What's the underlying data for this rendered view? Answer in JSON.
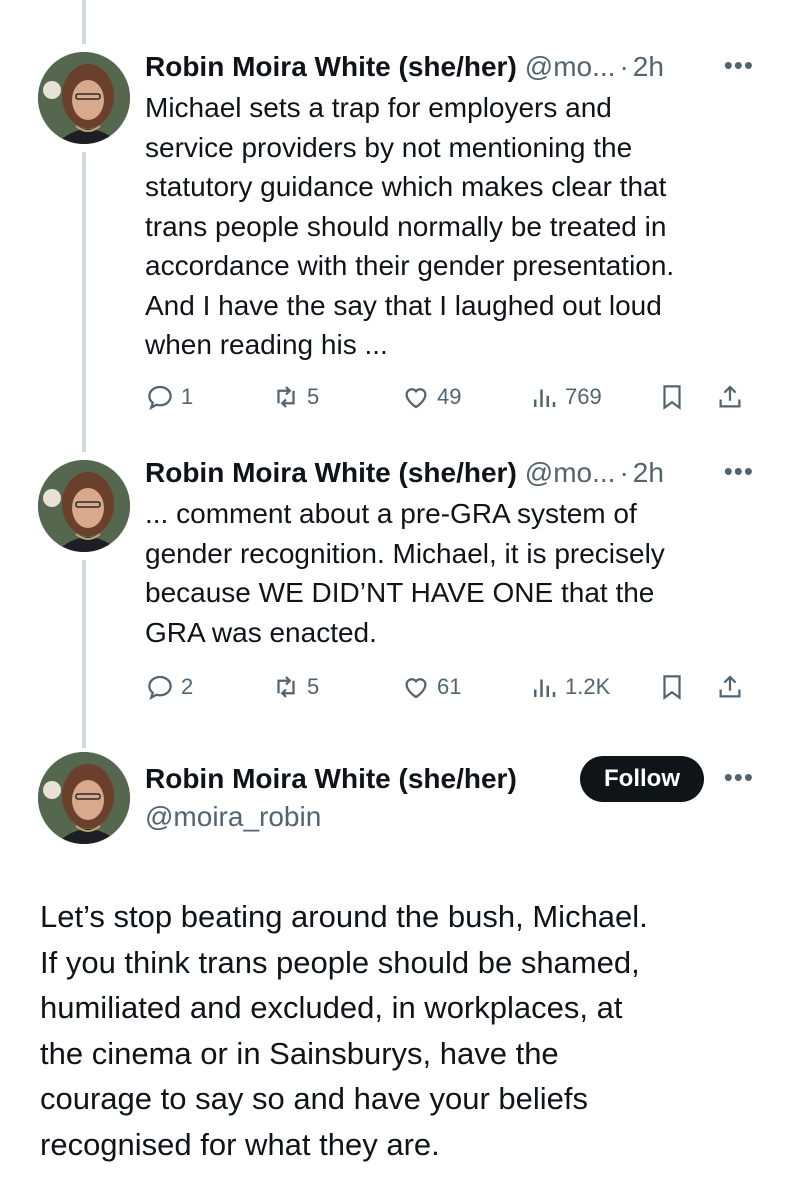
{
  "tweets": [
    {
      "author_name": "Robin Moira White (she/her)",
      "handle": "@mo...",
      "time": "2h",
      "text": "Michael sets a trap for employers and\nservice providers by not mentioning the\nstatutory guidance which makes clear that\ntrans people should normally be treated in\naccordance with their gender presentation.\nAnd I have the say that I laughed out loud\nwhen reading his ...",
      "stats": {
        "replies": "1",
        "reposts": "5",
        "likes": "49",
        "views": "769"
      }
    },
    {
      "author_name": "Robin Moira White (she/her)",
      "handle": "@mo...",
      "time": "2h",
      "text": "... comment about a pre-GRA system of\ngender recognition.  Michael, it is precisely\nbecause WE DID’NT HAVE ONE that the\nGRA was enacted.",
      "stats": {
        "replies": "2",
        "reposts": "5",
        "likes": "61",
        "views": "1.2K"
      }
    }
  ],
  "main_tweet": {
    "author_name": "Robin Moira White (she/her)",
    "handle": "@moira_robin",
    "follow_label": "Follow",
    "text": "Let’s stop beating around the bush, Michael.\nIf you think trans people should be shamed,\nhumiliated and excluded, in workplaces, at\nthe cinema or in Sainsburys, have the\ncourage to say so and have your beliefs\nrecognised for what they are."
  },
  "colors": {
    "text": "#0f1419",
    "secondary": "#536471",
    "thread_line": "#cfd9de",
    "button_bg": "#0f1419"
  },
  "icons": [
    "more-icon",
    "reply-icon",
    "repost-icon",
    "like-icon",
    "views-icon",
    "bookmark-icon",
    "share-icon"
  ]
}
